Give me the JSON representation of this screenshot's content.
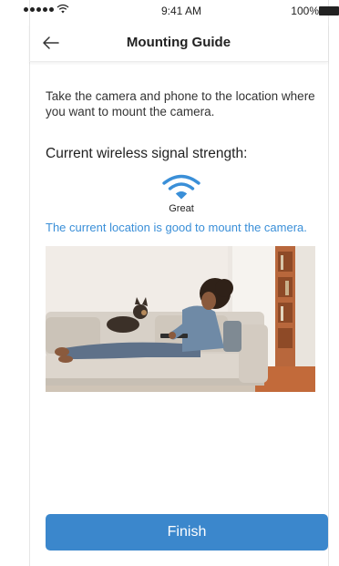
{
  "status_bar": {
    "time": "9:41 AM",
    "battery": "100%"
  },
  "nav": {
    "title": "Mounting Guide",
    "back_icon": "arrow-left-icon"
  },
  "content": {
    "instruction": "Take the camera and phone to the location where you want to mount the camera.",
    "signal_heading": "Current wireless signal strength:",
    "signal_icon": "wifi-icon",
    "signal_label": "Great",
    "location_message": "The current location is good to mount the camera.",
    "image_description_hidden": null
  },
  "footer": {
    "finish_label": "Finish"
  },
  "colors": {
    "accent": "#3b87cc",
    "message": "#3a8fd8"
  }
}
